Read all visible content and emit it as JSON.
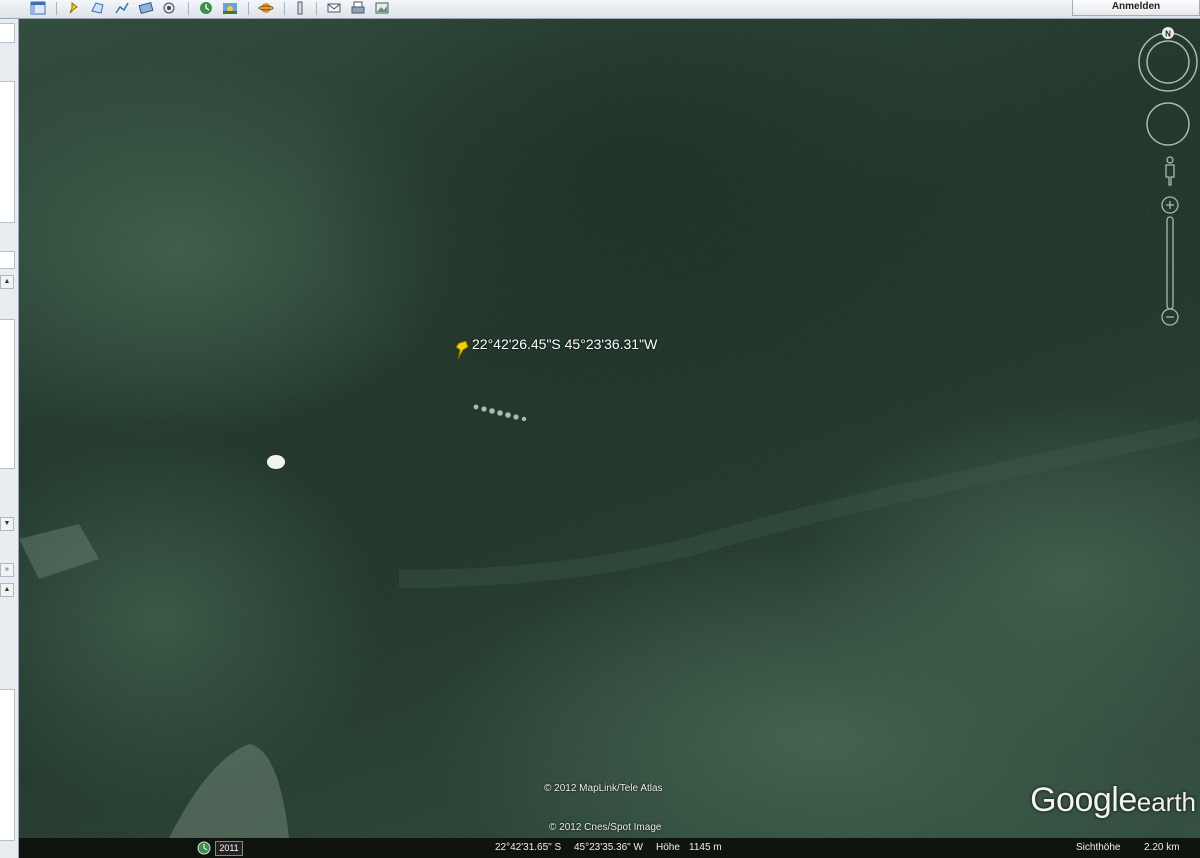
{
  "toolbar": {
    "signin_label": "Anmelden",
    "buttons": [
      "sidebar-toggle-icon",
      "placemark-icon",
      "polygon-icon",
      "path-icon",
      "image-overlay-icon",
      "record-tour-icon",
      "historical-imagery-icon",
      "sunlight-icon",
      "planets-icon",
      "ruler-icon",
      "email-icon",
      "print-icon",
      "save-image-icon"
    ]
  },
  "map": {
    "placemark_label": "22°42'26.45\"S 45°23'36.31\"W",
    "copyright_1": "© 2012 MapLink/Tele Atlas",
    "copyright_2": "© 2012 Cnes/Spot Image",
    "logo_main": "Google",
    "logo_sub": "earth",
    "compass_label": "N"
  },
  "statusbar": {
    "imagery_year": "2011",
    "latitude": "22°42'31.65\" S",
    "longitude": "45°23'35.36\" W",
    "elevation_label": "Höhe",
    "elevation_value": "1145 m",
    "eye_alt_label": "Sichthöhe",
    "eye_alt_value": "2.20 km"
  }
}
